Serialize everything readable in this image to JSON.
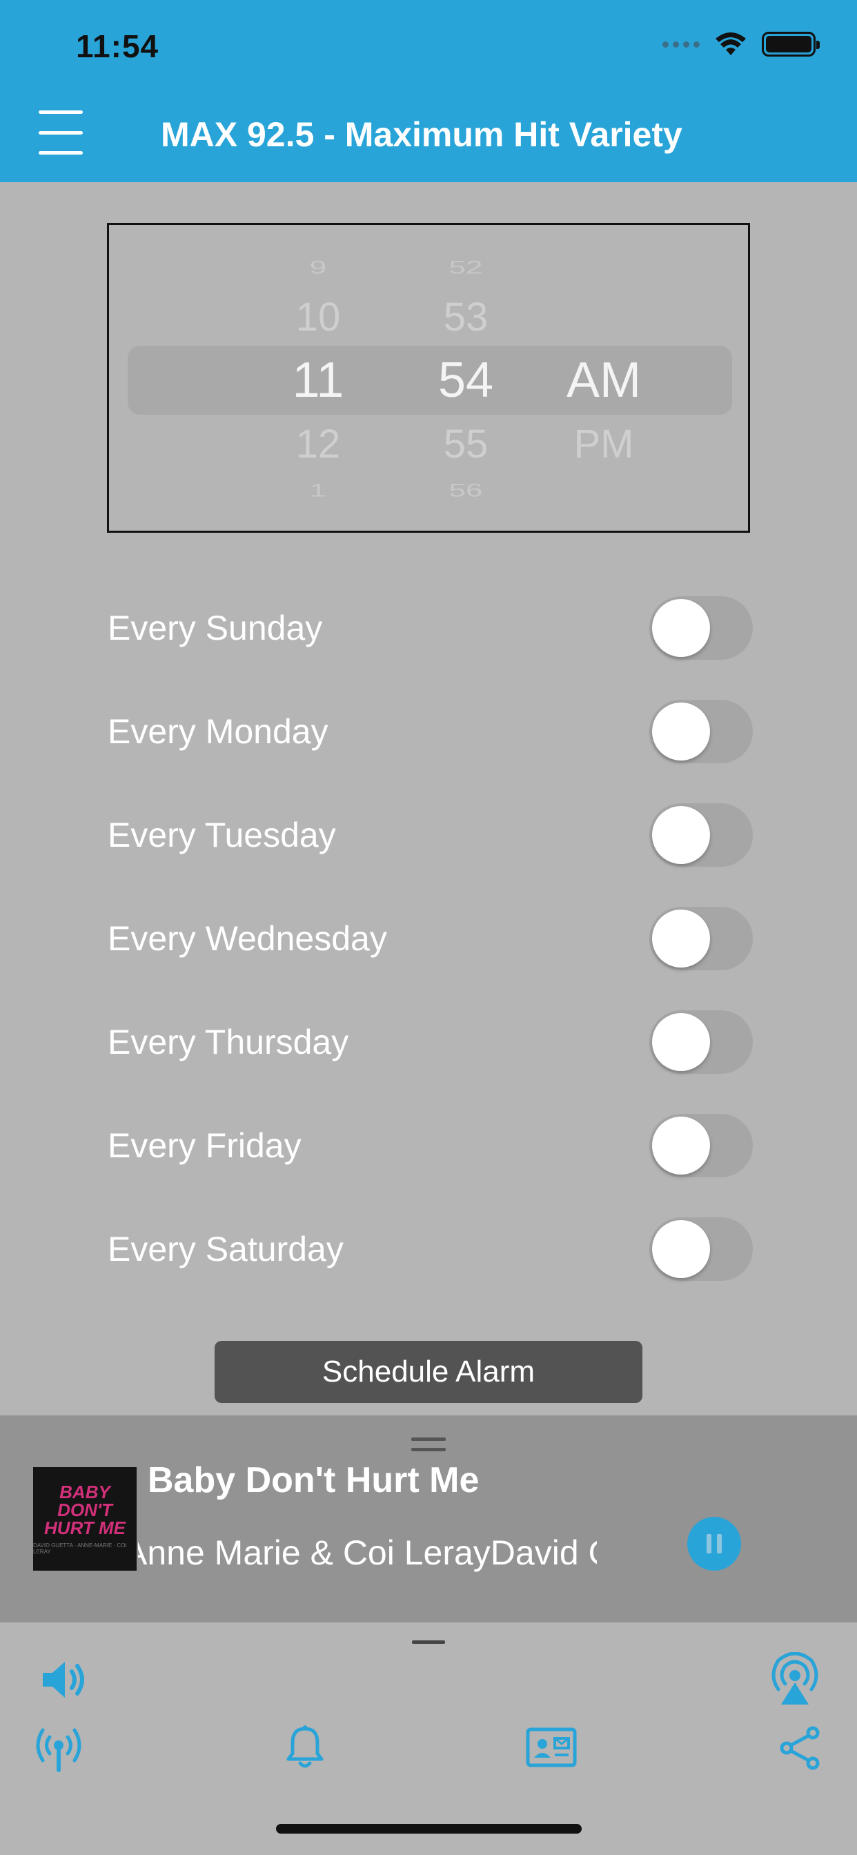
{
  "status_bar": {
    "time": "11:54"
  },
  "header": {
    "title": "MAX 92.5 - Maximum Hit Variety"
  },
  "picker": {
    "hours": [
      "9",
      "10",
      "11",
      "12",
      "1"
    ],
    "minutes": [
      "52",
      "53",
      "54",
      "55",
      "56"
    ],
    "periods": [
      "AM",
      "PM"
    ],
    "selected": {
      "hour": "11",
      "minute": "54",
      "period": "AM"
    }
  },
  "days": [
    {
      "label": "Every Sunday",
      "on": false
    },
    {
      "label": "Every Monday",
      "on": false
    },
    {
      "label": "Every Tuesday",
      "on": false
    },
    {
      "label": "Every Wednesday",
      "on": false
    },
    {
      "label": "Every Thursday",
      "on": false
    },
    {
      "label": "Every Friday",
      "on": false
    },
    {
      "label": "Every Saturday",
      "on": false
    }
  ],
  "schedule_button": {
    "label": "Schedule Alarm"
  },
  "now_playing": {
    "title": "Baby Don't Hurt Me",
    "artist": "Anne Marie & Coi LerayDavid Guetta",
    "art_text": "BABY DON'T HURT ME",
    "art_small": "DAVID GUETTA · ANNE-MARIE · COI LERAY"
  },
  "colors": {
    "accent": "#29a4d8",
    "background": "#b5b5b5",
    "player": "#939393"
  },
  "icons": {
    "bottom_row_top": [
      "volume-icon",
      "airplay-icon"
    ],
    "bottom_row_bottom": [
      "radio-tower-icon",
      "bell-icon",
      "contact-card-icon",
      "share-icon"
    ]
  }
}
